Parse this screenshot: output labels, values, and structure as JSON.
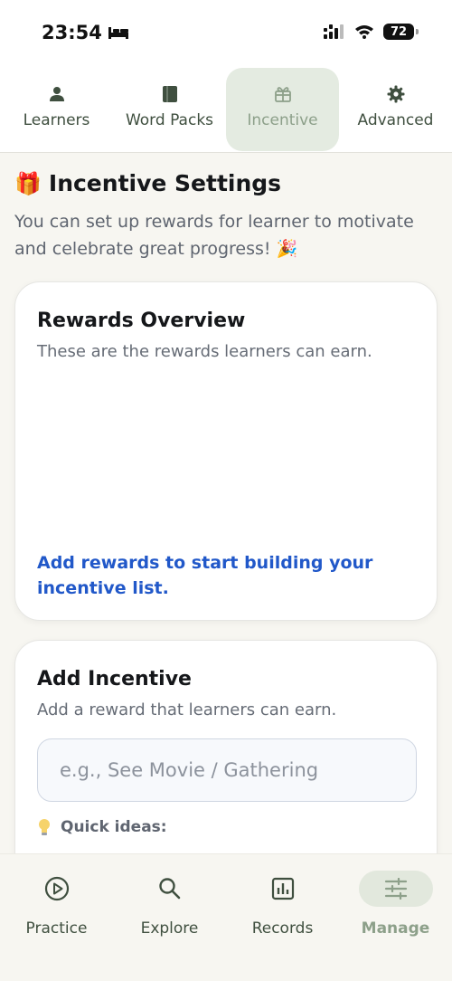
{
  "status": {
    "time": "23:54",
    "battery": "72"
  },
  "tabs": [
    {
      "label": "Learners",
      "icon": "person-icon"
    },
    {
      "label": "Word Packs",
      "icon": "book-icon"
    },
    {
      "label": "Incentive",
      "icon": "gift-icon",
      "active": true
    },
    {
      "label": "Advanced",
      "icon": "gear-icon"
    }
  ],
  "page": {
    "title": "Incentive Settings",
    "title_emoji": "🎁",
    "description": "You can set up rewards for learner to motivate and celebrate great progress! 🎉"
  },
  "rewards_overview": {
    "title": "Rewards Overview",
    "subtitle": "These are the rewards learners can earn.",
    "empty_text": "Add rewards to start building your incentive list."
  },
  "add_incentive": {
    "title": "Add Incentive",
    "subtitle": "Add a reward that learners can earn.",
    "input_placeholder": "e.g., See Movie / Gathering",
    "input_value": "",
    "quick_ideas_label": "Quick ideas:"
  },
  "bottom_nav": [
    {
      "label": "Practice",
      "icon": "play-circle-icon"
    },
    {
      "label": "Explore",
      "icon": "search-icon"
    },
    {
      "label": "Records",
      "icon": "bar-chart-icon"
    },
    {
      "label": "Manage",
      "icon": "sliders-icon",
      "active": true
    }
  ],
  "colors": {
    "accent": "#8da08a",
    "link": "#2158c9",
    "active_bg": "#e4ebe1"
  }
}
